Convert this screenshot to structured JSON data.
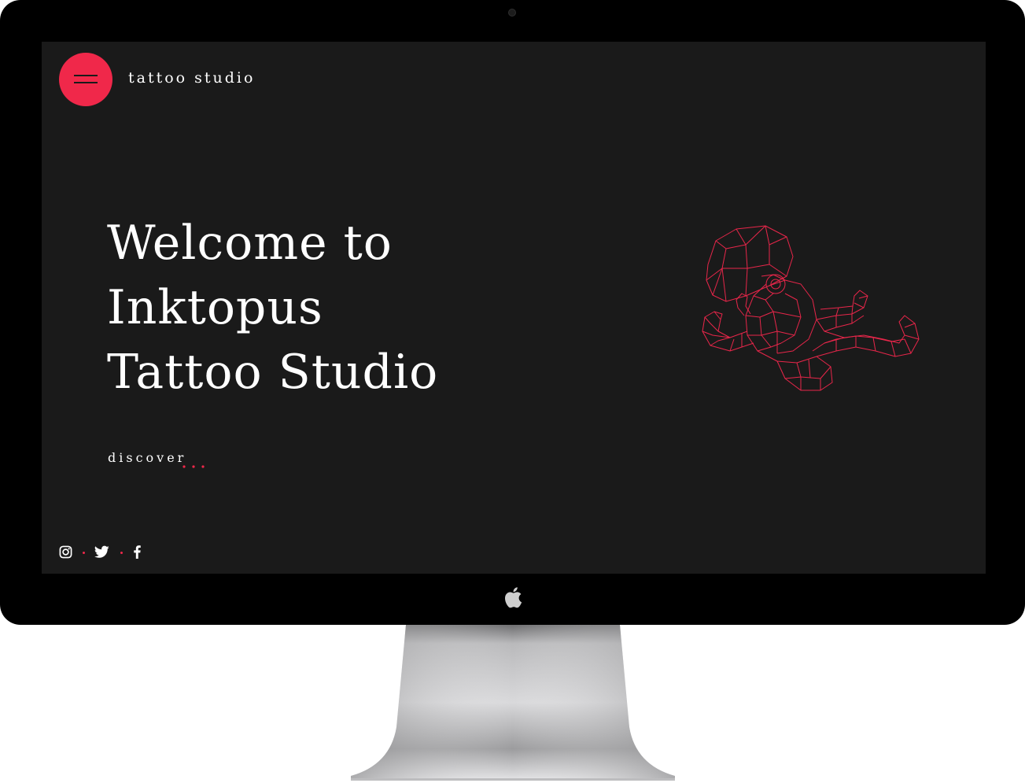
{
  "header": {
    "brand": "tattoo studio",
    "menu_icon": "hamburger-icon"
  },
  "hero": {
    "title_lines": [
      "Welcome to",
      "Inktopus",
      "Tattoo Studio"
    ],
    "discover_label": "discover"
  },
  "illustration": {
    "icon": "wireframe-octopus-illustration"
  },
  "social": {
    "icons": [
      "instagram-icon",
      "twitter-icon",
      "facebook-icon"
    ]
  },
  "device": {
    "logo_icon": "apple-icon"
  },
  "colors": {
    "accent": "#f0284a",
    "background": "#1a1a1a",
    "text": "#ffffff",
    "bezel": "#000000"
  }
}
